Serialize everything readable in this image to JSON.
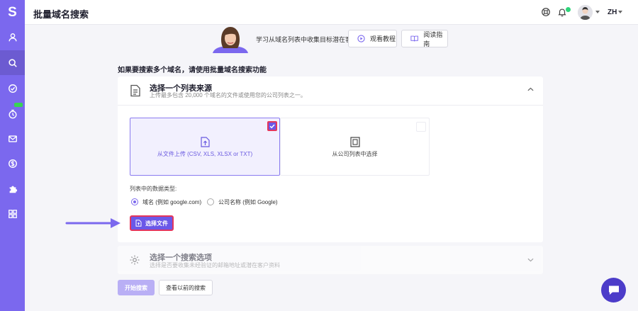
{
  "app": {
    "logo_letter": "S",
    "page_title": "批量域名搜索"
  },
  "header": {
    "language": "ZH"
  },
  "colors": {
    "brand": "#7b68ee",
    "accent_red": "#e4365c",
    "online_dot": "#2ed47a"
  },
  "sidebar": {
    "items": [
      {
        "icon": "user-icon"
      },
      {
        "icon": "search-icon",
        "active": true
      },
      {
        "icon": "check-circle-icon"
      },
      {
        "icon": "timer-icon",
        "badge": "new"
      },
      {
        "icon": "mail-icon"
      },
      {
        "icon": "dollar-icon"
      },
      {
        "icon": "puzzle-icon"
      },
      {
        "icon": "grid-icon"
      }
    ]
  },
  "banner": {
    "text": "学习从域名列表中收集目标潜在客户",
    "watch_label": "观看教程",
    "read_label": "阅读指南"
  },
  "main": {
    "instruction": "如果要搜索多个域名，请使用批量域名搜索功能",
    "source_section": {
      "title": "选择一个列表来源",
      "description": "上传最多包含 20,000 个域名的文件或使用您的公司列表之一。",
      "option_upload": "从文件上传 (CSV, XLS, XLSX or TXT)",
      "option_company": "从公司列表中选择",
      "data_type_label": "列表中的数据类型:",
      "radio_domain": "域名 (例如 google.com)",
      "radio_company": "公司名称 (例如 Google)",
      "choose_file": "选择文件"
    },
    "search_section": {
      "title": "选择一个搜索选项",
      "description": "选择是否要收集未经验证的邮箱地址或潜在客户资料"
    },
    "start_button": "开始搜索",
    "previous_button": "查看以前的搜索"
  }
}
